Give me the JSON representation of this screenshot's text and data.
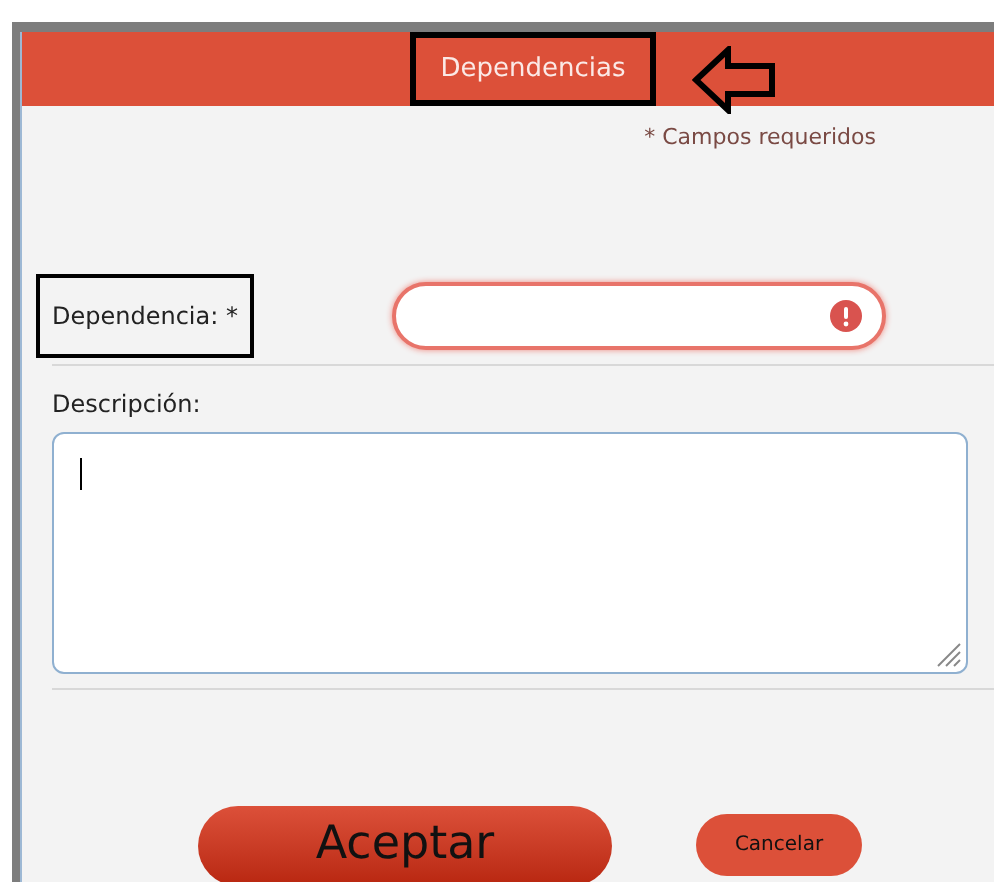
{
  "dialog": {
    "title": "Dependencias",
    "title_highlighted": true,
    "arrow_marker": true,
    "required_note": "* Campos requeridos"
  },
  "fields": [
    {
      "kind": "input",
      "label": "Dependencia: *",
      "highlighted": true,
      "error": true
    },
    {
      "kind": "textarea",
      "label": "Descripción:",
      "highlighted": false,
      "focused": true
    }
  ],
  "buttons": [
    {
      "label": "Aceptar",
      "kind": "primary"
    },
    {
      "label": "Cancelar",
      "kind": "secondary"
    }
  ]
}
